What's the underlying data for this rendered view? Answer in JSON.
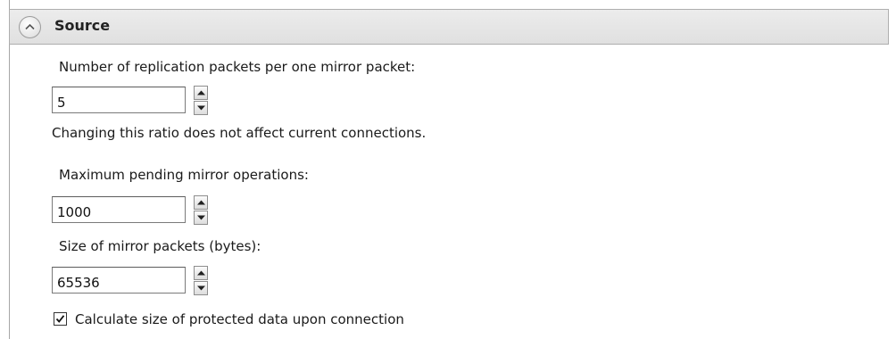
{
  "section": {
    "title": "Source",
    "collapse_icon": "chevron-up-icon"
  },
  "fields": {
    "replication_ratio": {
      "label": "Number of replication packets per one mirror packet:",
      "value": "5",
      "note": "Changing this ratio does not affect current connections."
    },
    "max_pending": {
      "label": "Maximum pending mirror operations:",
      "value": "1000"
    },
    "packet_size": {
      "label": "Size of mirror packets (bytes):",
      "value": "65536"
    }
  },
  "checkbox": {
    "label": "Calculate size of protected data upon connection",
    "checked": true
  },
  "colors": {
    "header_background": "#e6e6e6",
    "border": "#aeaeae"
  }
}
